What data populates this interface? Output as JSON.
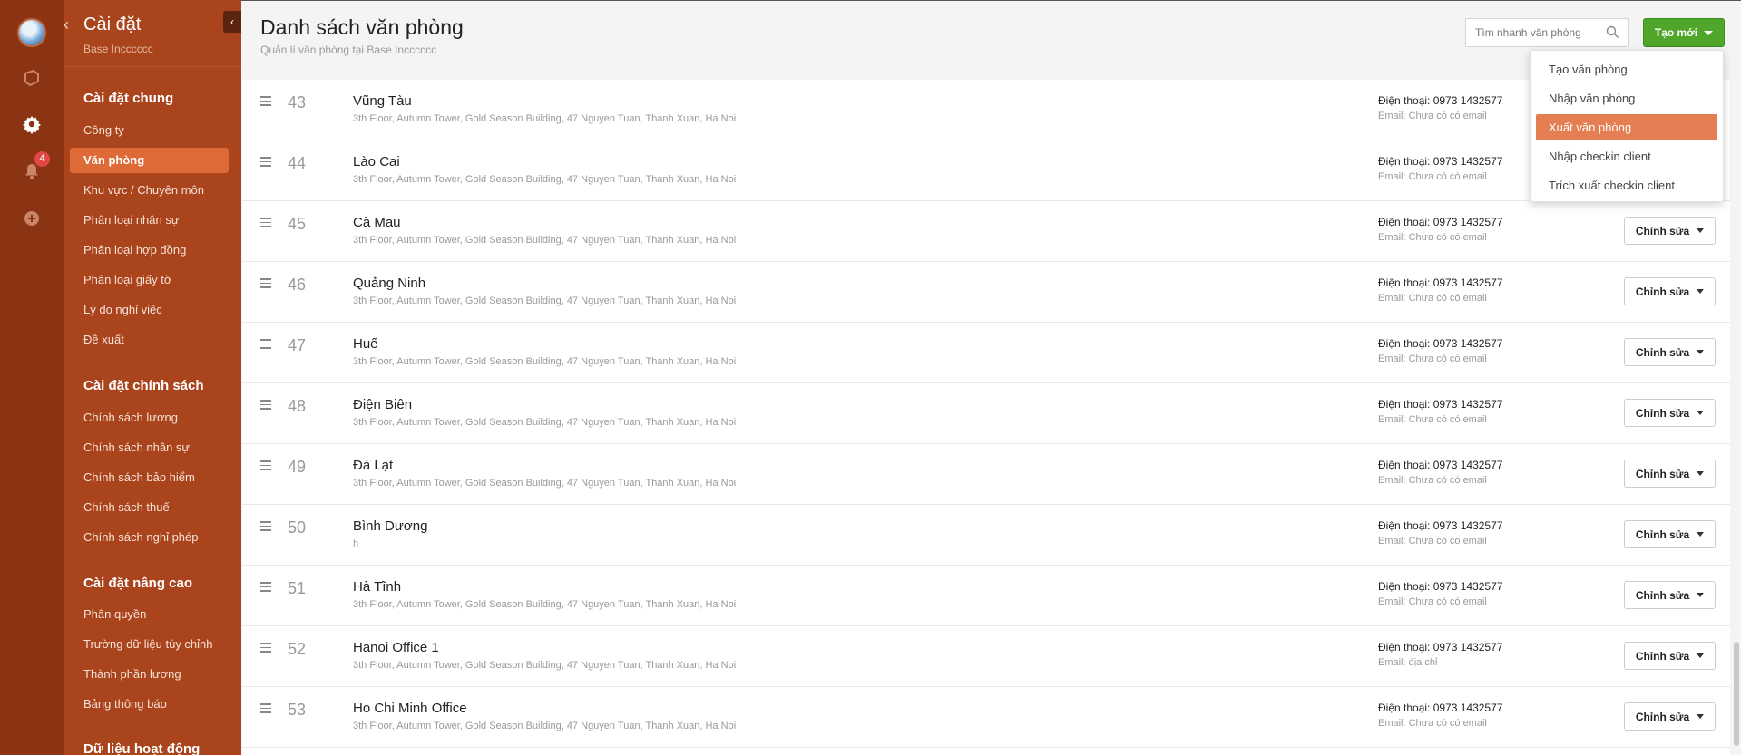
{
  "rail": {
    "notification_count": "4",
    "colors": {
      "rail_bg": "#8b3414",
      "badge": "#e04848"
    },
    "icons": [
      "avatar",
      "box-icon",
      "gear-icon",
      "bell-icon",
      "plus-circle-icon"
    ]
  },
  "nav": {
    "title": "Cài đặt",
    "subtitle": "Base Incccccc",
    "colors": {
      "panel_bg": "#a9441c",
      "active_bg": "#de6a37"
    },
    "sections": [
      {
        "title": "Cài đặt chung",
        "items": [
          "Công ty",
          "Văn phòng",
          "Khu vực / Chuyên môn",
          "Phân loại nhân sự",
          "Phân loại hợp đồng",
          "Phân loại giấy tờ",
          "Lý do nghỉ việc",
          "Đề xuất"
        ]
      },
      {
        "title": "Cài đặt chính sách",
        "items": [
          "Chính sách lương",
          "Chính sách nhân sự",
          "Chính sách bảo hiểm",
          "Chính sách thuế",
          "Chính sách nghỉ phép"
        ]
      },
      {
        "title": "Cài đặt nâng cao",
        "items": [
          "Phân quyền",
          "Trường dữ liệu tùy chỉnh",
          "Thành phần lương",
          "Bảng thông báo"
        ]
      },
      {
        "title": "Dữ liệu hoạt động",
        "items": []
      }
    ],
    "active_item": "Văn phòng"
  },
  "header": {
    "title": "Danh sách văn phòng",
    "subtitle": "Quản lí văn phòng tại Base Incccccc",
    "search_placeholder": "Tìm nhanh văn phòng",
    "create_label": "Tạo mới",
    "create_color": "#4fa62b"
  },
  "dropdown": {
    "items": [
      "Tạo văn phòng",
      "Nhập văn phòng",
      "Xuất văn phòng",
      "Nhập checkin client",
      "Trích xuất checkin client"
    ],
    "highlighted": "Xuất văn phòng",
    "highlight_color": "#e57e52"
  },
  "offices": [
    {
      "num": "43",
      "name": "Vũng Tàu",
      "address": "3th Floor, Autumn Tower, Gold Season Building, 47 Nguyen Tuan, Thanh Xuan, Ha Noi",
      "phone": "Điện thoại: 0973 1432577",
      "email": "Email: Chưa có có email"
    },
    {
      "num": "44",
      "name": "Lào Cai",
      "address": "3th Floor, Autumn Tower, Gold Season Building, 47 Nguyen Tuan, Thanh Xuan, Ha Noi",
      "phone": "Điện thoại: 0973 1432577",
      "email": "Email: Chưa có có email"
    },
    {
      "num": "45",
      "name": "Cà Mau",
      "address": "3th Floor, Autumn Tower, Gold Season Building, 47 Nguyen Tuan, Thanh Xuan, Ha Noi",
      "phone": "Điện thoại: 0973 1432577",
      "email": "Email: Chưa có có email",
      "edit_label": "Chỉnh sửa"
    },
    {
      "num": "46",
      "name": "Quảng Ninh",
      "address": "3th Floor, Autumn Tower, Gold Season Building, 47 Nguyen Tuan, Thanh Xuan, Ha Noi",
      "phone": "Điện thoại: 0973 1432577",
      "email": "Email: Chưa có có email",
      "edit_label": "Chỉnh sửa"
    },
    {
      "num": "47",
      "name": "Huế",
      "address": "3th Floor, Autumn Tower, Gold Season Building, 47 Nguyen Tuan, Thanh Xuan, Ha Noi",
      "phone": "Điện thoại: 0973 1432577",
      "email": "Email: Chưa có có email",
      "edit_label": "Chỉnh sửa"
    },
    {
      "num": "48",
      "name": "Điện Biên",
      "address": "3th Floor, Autumn Tower, Gold Season Building, 47 Nguyen Tuan, Thanh Xuan, Ha Noi",
      "phone": "Điện thoại: 0973 1432577",
      "email": "Email: Chưa có có email",
      "edit_label": "Chỉnh sửa"
    },
    {
      "num": "49",
      "name": "Đà Lạt",
      "address": "3th Floor, Autumn Tower, Gold Season Building, 47 Nguyen Tuan, Thanh Xuan, Ha Noi",
      "phone": "Điện thoại: 0973 1432577",
      "email": "Email: Chưa có có email",
      "edit_label": "Chỉnh sửa"
    },
    {
      "num": "50",
      "name": "Bình Dương",
      "address": "h",
      "phone": "Điện thoại: 0973 1432577",
      "email": "Email: Chưa có có email",
      "edit_label": "Chỉnh sửa"
    },
    {
      "num": "51",
      "name": "Hà Tĩnh",
      "address": "3th Floor, Autumn Tower, Gold Season Building, 47 Nguyen Tuan, Thanh Xuan, Ha Noi",
      "phone": "Điện thoại: 0973 1432577",
      "email": "Email: Chưa có có email",
      "edit_label": "Chỉnh sửa"
    },
    {
      "num": "52",
      "name": "Hanoi Office 1",
      "address": "3th Floor, Autumn Tower, Gold Season Building, 47 Nguyen Tuan, Thanh Xuan, Ha Noi",
      "phone": "Điện thoại: 0973 1432577",
      "email": "Email: địa chỉ",
      "edit_label": "Chỉnh sửa"
    },
    {
      "num": "53",
      "name": "Ho Chi Minh Office",
      "address": "3th Floor, Autumn Tower, Gold Season Building, 47 Nguyen Tuan, Thanh Xuan, Ha Noi",
      "phone": "Điện thoại: 0973 1432577",
      "email": "Email: Chưa có có email",
      "edit_label": "Chỉnh sửa"
    }
  ]
}
